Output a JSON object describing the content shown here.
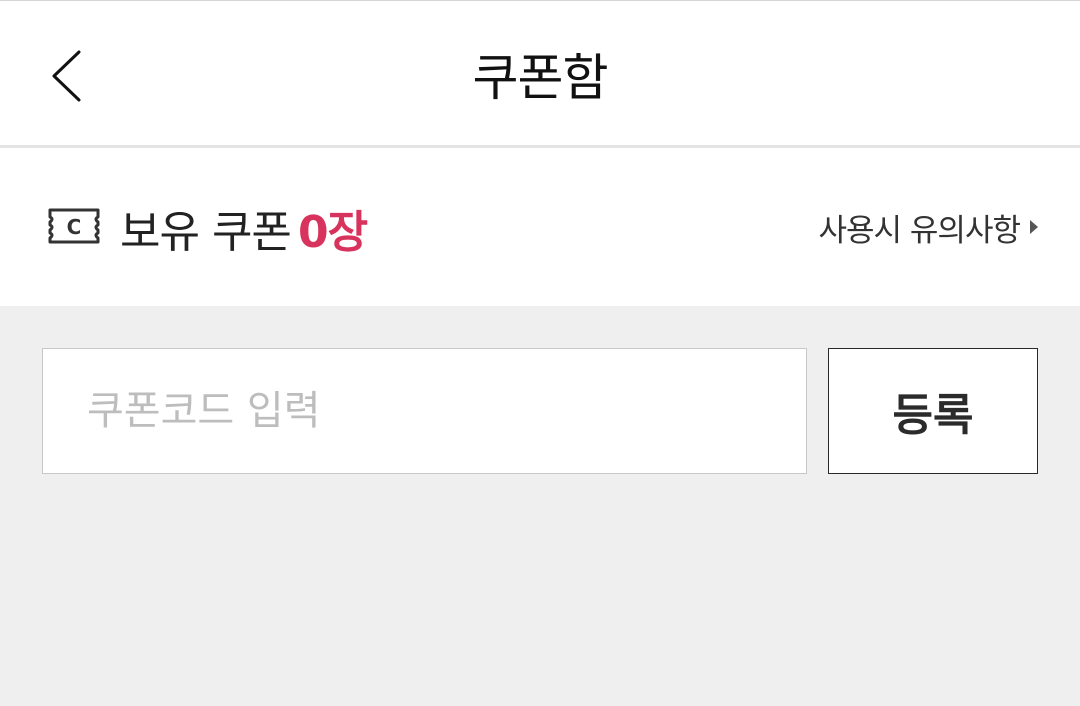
{
  "header": {
    "title": "쿠폰함",
    "back_icon": "chevron-left-icon"
  },
  "summary": {
    "icon": "coupon-ticket-icon",
    "icon_letter": "C",
    "label": "보유 쿠폰",
    "count": "0장",
    "count_color": "#d8335c",
    "notice_link": "사용시 유의사항",
    "notice_icon": "caret-right-icon"
  },
  "register": {
    "placeholder": "쿠폰코드 입력",
    "value": "",
    "button_label": "등록"
  },
  "colors": {
    "background": "#efefef",
    "surface": "#ffffff",
    "accent": "#d8335c"
  }
}
